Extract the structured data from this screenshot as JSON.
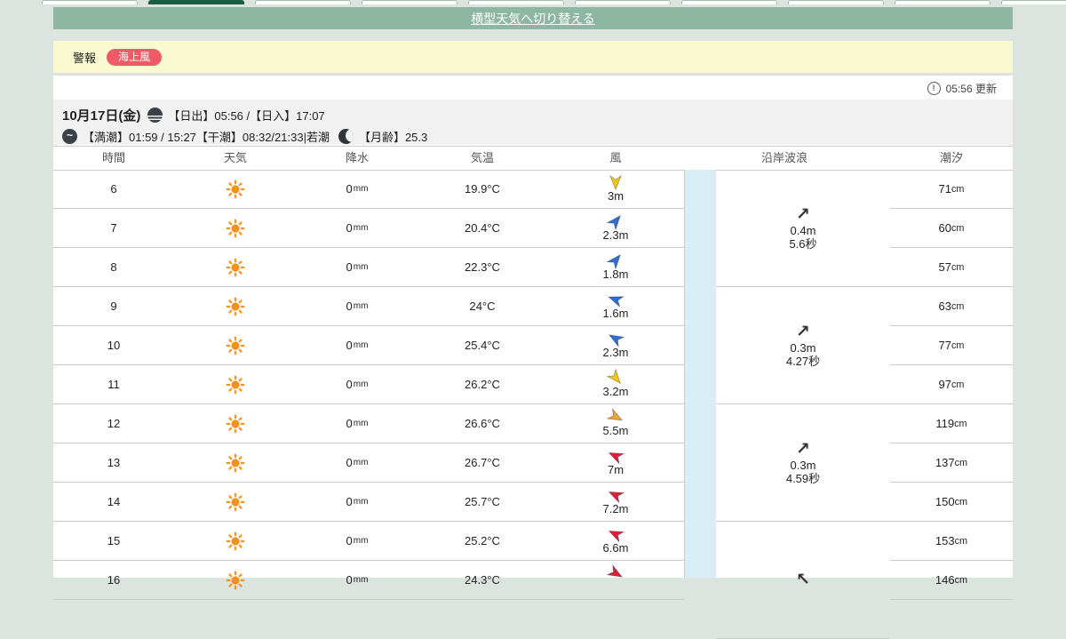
{
  "colors": {
    "page_bg": "#dce4e0",
    "banner_green": "#8db6a3",
    "tab_selected": "#1c5a41",
    "alert_bg": "#fafad2",
    "badge_red": "#ee5a66",
    "strip_blue": "#d9edf7",
    "band_bg": "#f1f1f1",
    "border": "#cccccc",
    "sun_icon": "#f5921e"
  },
  "top_tabs": {
    "count": 10,
    "selected_index": 1
  },
  "banner": {
    "switch_link": "横型天気へ切り替える"
  },
  "alert": {
    "label": "警報",
    "badge": "海上風"
  },
  "update": {
    "time_label": "05:56 更新"
  },
  "date_header": {
    "date": "10月17日(金)",
    "sun_times": "【日出】05:56 /【日入】17:07",
    "tide_times": "【満潮】01:59 / 15:27【干潮】08:32/21:33|若潮",
    "moon_age": "【月齢】25.3"
  },
  "table": {
    "headers": [
      "時間",
      "天気",
      "降水",
      "気温",
      "風",
      "沿岸波浪",
      "潮汐"
    ],
    "rows": [
      {
        "time": "6",
        "weather": "sunny",
        "precip": "0",
        "precip_unit": "mm",
        "temp": "19.9°C",
        "wind": {
          "label": "3m",
          "dir_deg": 180,
          "color": "#f2c716"
        },
        "tide": "71",
        "tide_unit": "cm"
      },
      {
        "time": "7",
        "weather": "sunny",
        "precip": "0",
        "precip_unit": "mm",
        "temp": "20.4°C",
        "wind": {
          "label": "2.3m",
          "dir_deg": 40,
          "color": "#2e6fd3"
        },
        "tide": "60",
        "tide_unit": "cm"
      },
      {
        "time": "8",
        "weather": "sunny",
        "precip": "0",
        "precip_unit": "mm",
        "temp": "22.3°C",
        "wind": {
          "label": "1.8m",
          "dir_deg": 40,
          "color": "#2e6fd3"
        },
        "tide": "57",
        "tide_unit": "cm"
      },
      {
        "time": "9",
        "weather": "sunny",
        "precip": "0",
        "precip_unit": "mm",
        "temp": "24°C",
        "wind": {
          "label": "1.6m",
          "dir_deg": 290,
          "color": "#2e6fd3"
        },
        "tide": "63",
        "tide_unit": "cm"
      },
      {
        "time": "10",
        "weather": "sunny",
        "precip": "0",
        "precip_unit": "mm",
        "temp": "25.4°C",
        "wind": {
          "label": "2.3m",
          "dir_deg": 300,
          "color": "#2e6fd3"
        },
        "tide": "77",
        "tide_unit": "cm"
      },
      {
        "time": "11",
        "weather": "sunny",
        "precip": "0",
        "precip_unit": "mm",
        "temp": "26.2°C",
        "wind": {
          "label": "3.2m",
          "dir_deg": 140,
          "color": "#f2c716"
        },
        "tide": "97",
        "tide_unit": "cm"
      },
      {
        "time": "12",
        "weather": "sunny",
        "precip": "0",
        "precip_unit": "mm",
        "temp": "26.6°C",
        "wind": {
          "label": "5.5m",
          "dir_deg": 118,
          "color": "#eea236"
        },
        "tide": "119",
        "tide_unit": "cm"
      },
      {
        "time": "13",
        "weather": "sunny",
        "precip": "0",
        "precip_unit": "mm",
        "temp": "26.7°C",
        "wind": {
          "label": "7m",
          "dir_deg": 295,
          "color": "#e01e3c"
        },
        "tide": "137",
        "tide_unit": "cm"
      },
      {
        "time": "14",
        "weather": "sunny",
        "precip": "0",
        "precip_unit": "mm",
        "temp": "25.7°C",
        "wind": {
          "label": "7.2m",
          "dir_deg": 295,
          "color": "#e01e3c"
        },
        "tide": "150",
        "tide_unit": "cm"
      },
      {
        "time": "15",
        "weather": "sunny",
        "precip": "0",
        "precip_unit": "mm",
        "temp": "25.2°C",
        "wind": {
          "label": "6.6m",
          "dir_deg": 295,
          "color": "#e01e3c"
        },
        "tide": "153",
        "tide_unit": "cm"
      },
      {
        "time": "16",
        "weather": "sunny",
        "precip": "0",
        "precip_unit": "mm",
        "temp": "24.3°C",
        "wind": {
          "label": "",
          "dir_deg": 120,
          "color": "#e01e3c"
        },
        "tide": "146",
        "tide_unit": "cm"
      }
    ],
    "wave_groups": [
      {
        "arrow": "↗",
        "height": "0.4m",
        "period": "5.6秒"
      },
      {
        "arrow": "↗",
        "height": "0.3m",
        "period": "4.27秒"
      },
      {
        "arrow": "↗",
        "height": "0.3m",
        "period": "4.59秒"
      },
      {
        "arrow": "↖",
        "height": "",
        "period": ""
      }
    ]
  }
}
